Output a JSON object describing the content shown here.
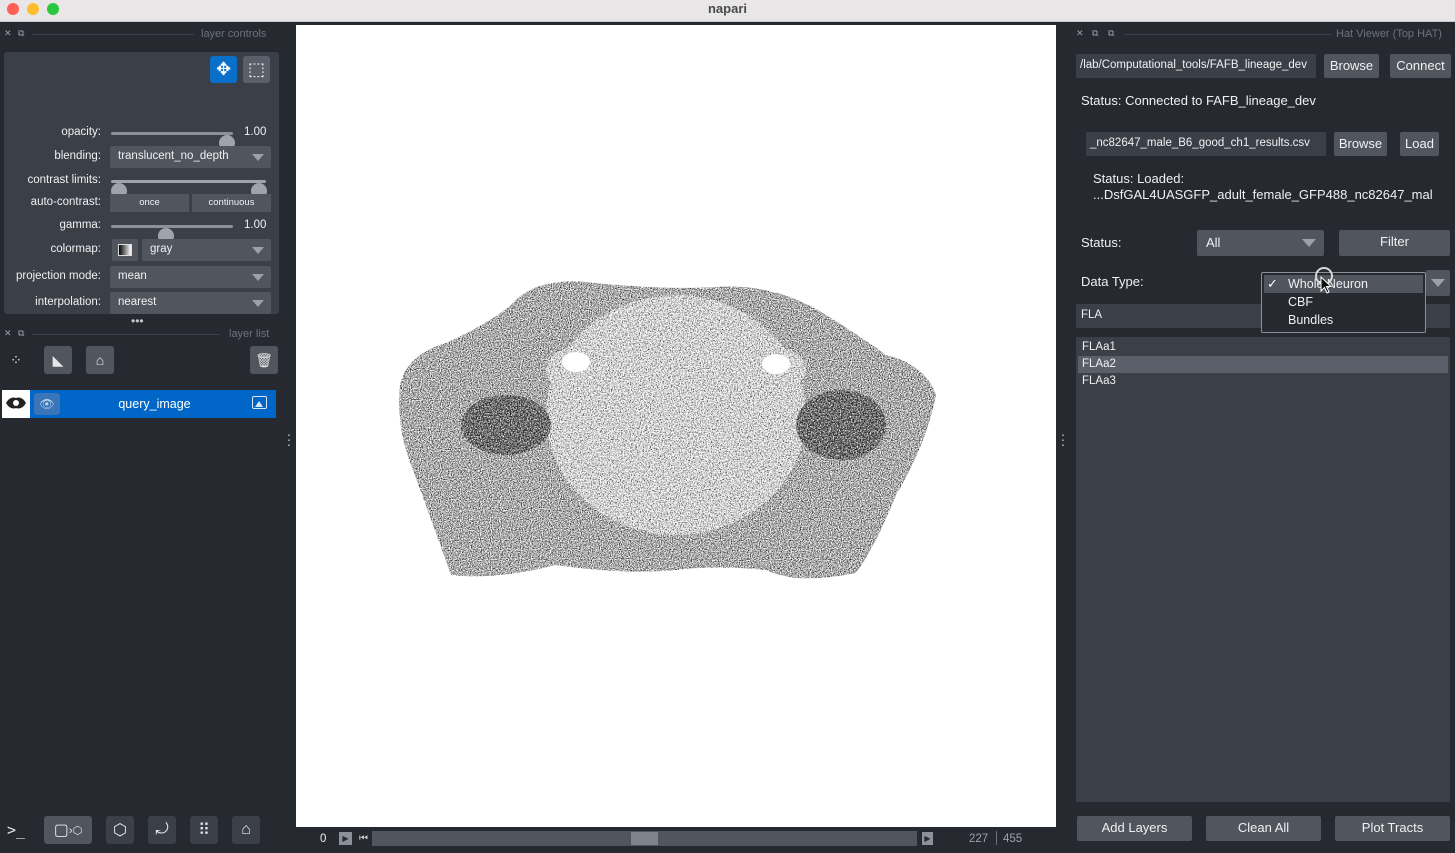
{
  "window": {
    "title": "napari"
  },
  "layer_controls": {
    "header": "layer controls",
    "opacity": {
      "label": "opacity:",
      "value": "1.00",
      "fraction": 1.0
    },
    "blending": {
      "label": "blending:",
      "value": "translucent_no_depth"
    },
    "contrast_limits": {
      "label": "contrast limits:",
      "low_fraction": 0.0,
      "high_fraction": 1.0
    },
    "auto_contrast": {
      "label": "auto-contrast:",
      "once": "once",
      "continuous": "continuous"
    },
    "gamma": {
      "label": "gamma:",
      "value": "1.00",
      "fraction": 0.45
    },
    "colormap": {
      "label": "colormap:",
      "value": "gray"
    },
    "projection_mode": {
      "label": "projection mode:",
      "value": "mean"
    },
    "interpolation": {
      "label": "interpolation:",
      "value": "nearest"
    }
  },
  "layer_list": {
    "header": "layer list",
    "layers": [
      {
        "name": "query_image",
        "visible": true,
        "selected": true
      }
    ]
  },
  "dims": {
    "index": "0",
    "current": "227",
    "total": "455",
    "fraction": 0.5
  },
  "hat_viewer": {
    "header": "Hat Viewer (Top HAT)",
    "db_path": "/lab/Computational_tools/FAFB_lineage_dev",
    "browse_label": "Browse",
    "connect_label": "Connect",
    "connection_status": "Status: Connected to FAFB_lineage_dev",
    "csv_path": "_nc82647_male_B6_good_ch1_results.csv",
    "load_label": "Load",
    "load_status_title": "Status: Loaded:",
    "load_status_value": "...DsfGAL4UASGFP_adult_female_GFP488_nc82647_mal",
    "status_label": "Status:",
    "status_value": "All",
    "filter_label": "Filter",
    "data_type_label": "Data Type:",
    "data_type_options": [
      "Whole Neuron",
      "CBF",
      "Bundles"
    ],
    "data_type_selected": "Whole Neuron",
    "search_value": "FLA",
    "results": [
      "FLAa1",
      "FLAa2",
      "FLAa3"
    ],
    "selected_result": "FLAa2",
    "add_layers_label": "Add Layers",
    "clean_all_label": "Clean All",
    "plot_tracts_label": "Plot Tracts"
  },
  "colors": {
    "accent": "#0066c7",
    "panel": "#3b3f47",
    "background": "#262930"
  }
}
